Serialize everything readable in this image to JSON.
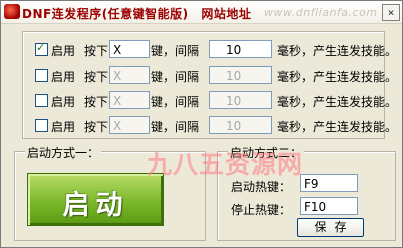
{
  "window": {
    "title": "DNF连发程序(任意键智能版)",
    "site_label": "网站地址",
    "url": "www.dnflianfa.com",
    "close_label": "×"
  },
  "rows": [
    {
      "checked": true,
      "enable_label": "启用",
      "press_label": "按下",
      "key": "X",
      "key_label": "键，间隔",
      "interval": "10",
      "ms_label": "毫秒，产生连发技能。"
    },
    {
      "checked": false,
      "enable_label": "启用",
      "press_label": "按下",
      "key": "X",
      "key_label": "键，间隔",
      "interval": "10",
      "ms_label": "毫秒，产生连发技能。"
    },
    {
      "checked": false,
      "enable_label": "启用",
      "press_label": "按下",
      "key": "X",
      "key_label": "键，间隔",
      "interval": "10",
      "ms_label": "毫秒，产生连发技能。"
    },
    {
      "checked": false,
      "enable_label": "启用",
      "press_label": "按下",
      "key": "X",
      "key_label": "键，间隔",
      "interval": "10",
      "ms_label": "毫秒，产生连发技能。"
    }
  ],
  "start_mode_1": {
    "legend": "启动方式一：",
    "start_label": "启动"
  },
  "start_mode_2": {
    "legend": "启动方式二：",
    "hotkey_label": "启动热键：",
    "hotkey_value": "F9",
    "stop_label": "停止热键：",
    "stop_value": "F10",
    "save_label": "保存"
  },
  "watermark": "九八五资源网",
  "colors": {
    "title": "#9c0000",
    "start_button": "#7bb82a",
    "watermark": "#ff7b86"
  }
}
